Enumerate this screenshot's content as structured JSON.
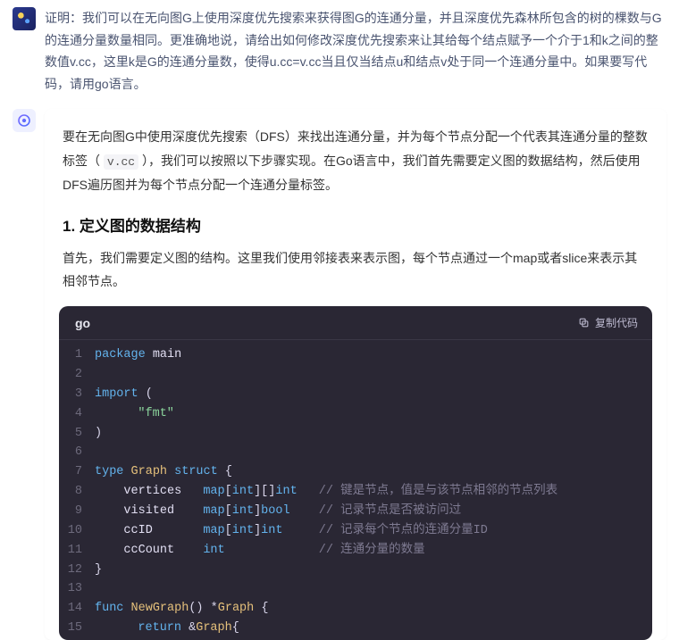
{
  "user": {
    "message": "证明：我们可以在无向图G上使用深度优先搜索来获得图G的连通分量，并且深度优先森林所包含的树的棵数与G的连通分量数量相同。更准确地说，请给出如何修改深度优先搜索来让其给每个结点赋予一个介于1和k之间的整数值v.cc，这里k是G的连通分量数，使得u.cc=v.cc当且仅当结点u和结点v处于同一个连通分量中。如果要写代码，请用go语言。"
  },
  "assistant": {
    "intro_prefix": "要在无向图G中使用深度优先搜索（DFS）来找出连通分量，并为每个节点分配一个代表其连通分量的整数标签（",
    "intro_code": "v.cc",
    "intro_suffix": "），我们可以按照以下步骤实现。在Go语言中，我们首先需要定义图的数据结构，然后使用DFS遍历图并为每个节点分配一个连通分量标签。",
    "section1_title": "1. 定义图的数据结构",
    "section1_para": "首先，我们需要定义图的结构。这里我们使用邻接表来表示图，每个节点通过一个map或者slice来表示其相邻节点。"
  },
  "code_block": {
    "language": "go",
    "copy_label": "复制代码",
    "lines": [
      {
        "n": "1",
        "tokens": [
          [
            "kw",
            "package "
          ],
          [
            "name",
            "main"
          ]
        ]
      },
      {
        "n": "2",
        "tokens": []
      },
      {
        "n": "3",
        "tokens": [
          [
            "kw",
            "import "
          ],
          [
            "punc",
            "("
          ]
        ]
      },
      {
        "n": "4",
        "tokens": [
          [
            "plain",
            "    "
          ],
          [
            "str",
            "\"fmt\""
          ]
        ]
      },
      {
        "n": "5",
        "tokens": [
          [
            "punc",
            ")"
          ]
        ]
      },
      {
        "n": "6",
        "tokens": []
      },
      {
        "n": "7",
        "tokens": [
          [
            "kw",
            "type "
          ],
          [
            "type",
            "Graph "
          ],
          [
            "kw",
            "struct "
          ],
          [
            "punc",
            "{"
          ]
        ]
      },
      {
        "n": "8",
        "tokens": [
          [
            "plain",
            "    vertices "
          ],
          [
            "kw",
            "map"
          ],
          [
            "punc",
            "["
          ],
          [
            "builtin",
            "int"
          ],
          [
            "punc",
            "][]"
          ],
          [
            "builtin",
            "int"
          ],
          [
            "plain",
            " "
          ],
          [
            "comment",
            "// 键是节点，值是与该节点相邻的节点列表"
          ]
        ]
      },
      {
        "n": "9",
        "tokens": [
          [
            "plain",
            "    visited  "
          ],
          [
            "kw",
            "map"
          ],
          [
            "punc",
            "["
          ],
          [
            "builtin",
            "int"
          ],
          [
            "punc",
            "]"
          ],
          [
            "builtin",
            "bool"
          ],
          [
            "plain",
            "  "
          ],
          [
            "comment",
            "// 记录节点是否被访问过"
          ]
        ]
      },
      {
        "n": "10",
        "tokens": [
          [
            "plain",
            "    ccID     "
          ],
          [
            "kw",
            "map"
          ],
          [
            "punc",
            "["
          ],
          [
            "builtin",
            "int"
          ],
          [
            "punc",
            "]"
          ],
          [
            "builtin",
            "int"
          ],
          [
            "plain",
            "   "
          ],
          [
            "comment",
            "// 记录每个节点的连通分量ID"
          ]
        ]
      },
      {
        "n": "11",
        "tokens": [
          [
            "plain",
            "    ccCount  "
          ],
          [
            "builtin",
            "int"
          ],
          [
            "plain",
            "           "
          ],
          [
            "comment",
            "// 连通分量的数量"
          ]
        ]
      },
      {
        "n": "12",
        "tokens": [
          [
            "punc",
            "}"
          ]
        ]
      },
      {
        "n": "13",
        "tokens": []
      },
      {
        "n": "14",
        "tokens": [
          [
            "kw",
            "func "
          ],
          [
            "func",
            "NewGraph"
          ],
          [
            "punc",
            "() "
          ],
          [
            "star",
            "*"
          ],
          [
            "type",
            "Graph "
          ],
          [
            "punc",
            "{"
          ]
        ]
      },
      {
        "n": "15",
        "tokens": [
          [
            "plain",
            "    "
          ],
          [
            "kw",
            "return "
          ],
          [
            "punc",
            "&"
          ],
          [
            "type",
            "Graph"
          ],
          [
            "punc",
            "{"
          ]
        ]
      }
    ]
  }
}
